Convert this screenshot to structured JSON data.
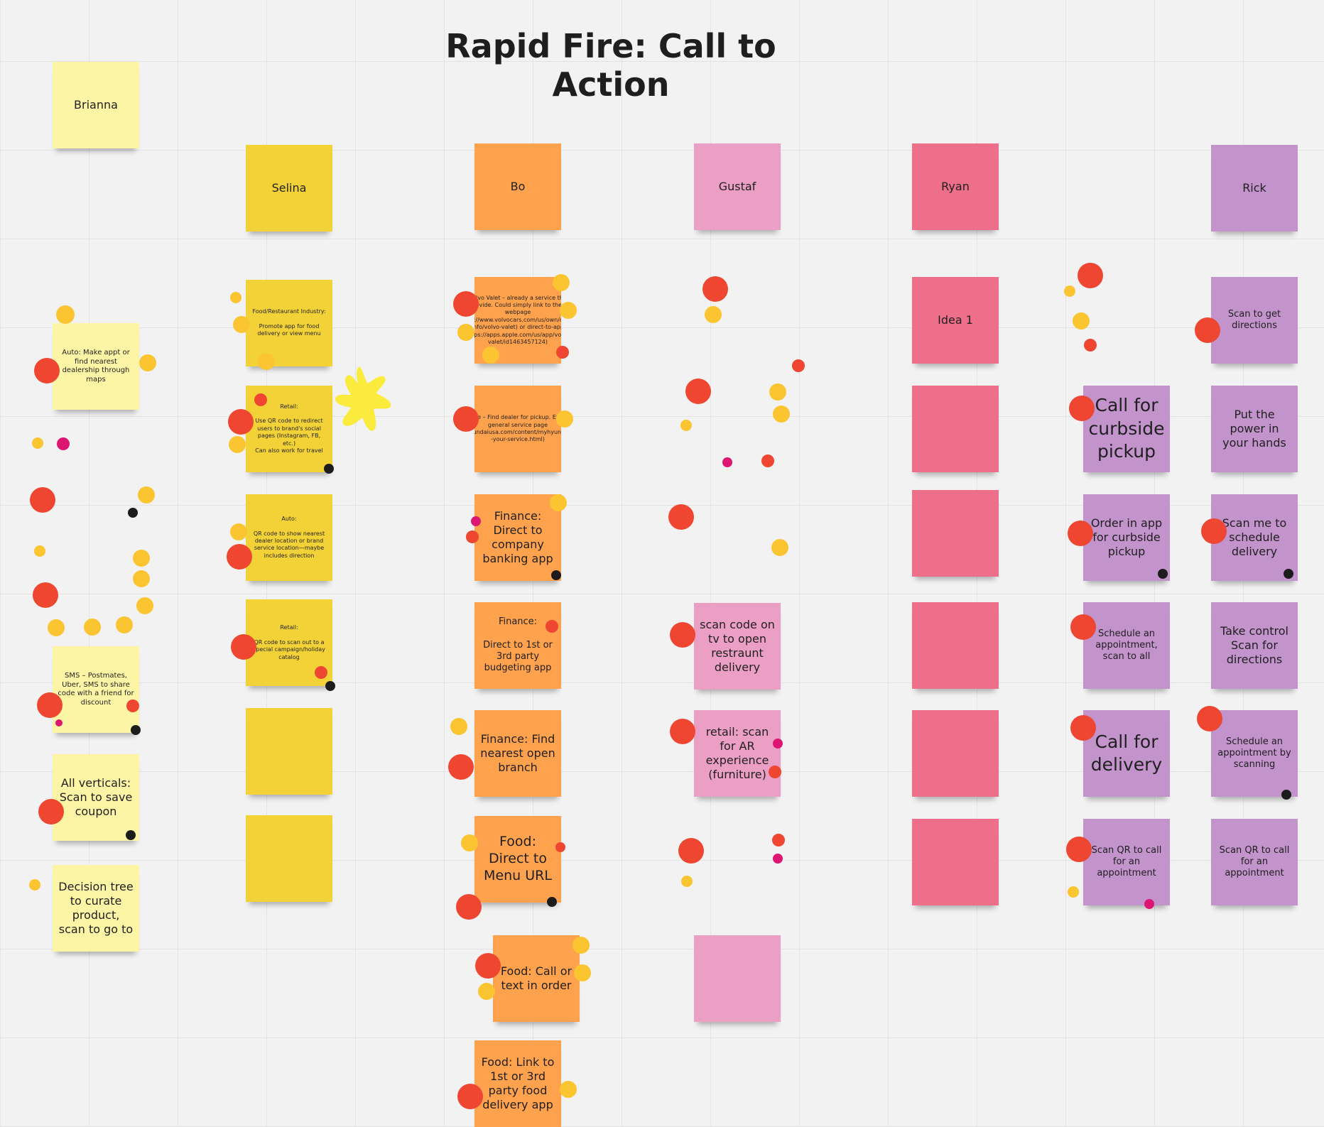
{
  "title": "Rapid Fire: Call to Action",
  "colors": {
    "yellow_light": "#fdf5a6",
    "yellow": "#f3d237",
    "orange": "#fea24e",
    "pink_light": "#ec9fc4",
    "pink": "#ed6f8a",
    "purple": "#c393cc",
    "vote_red": "#ef4631",
    "vote_yellow": "#fbc531",
    "vote_magenta": "#dc1672",
    "vote_black": "#1c1c1c"
  },
  "columns": [
    {
      "key": "brianna",
      "header": "Brianna",
      "notes": [
        "Auto: Make appt or find nearest dealership through maps",
        "SMS – Postmates, Uber, SMS to share code with a friend for discount",
        "All verticals: Scan to save coupon",
        "Decision tree to curate product, scan to go to"
      ]
    },
    {
      "key": "selina",
      "header": "Selina",
      "notes": [
        "Food/Restaurant Industry:\n\nPromote app for food delivery or view menu",
        "Retail:\n\nUse QR code to redirect users to brand's social pages (Instagram, FB, etc.)\nCan also work for travel",
        "Auto:\n\nQR code to show nearest dealer location or brand service location—maybe includes direction",
        "Retail:\n\nQR code to scan out to a special campaign/holiday catalog",
        "",
        ""
      ]
    },
    {
      "key": "bo",
      "header": "Bo",
      "notes": [
        "Volvo Valet – already a service the provide. Could simply link to their webpage (https://www.volvocars.com/us/own/owner-info/volvo-valet) or direct-to-app (https://apps.apple.com/us/app/volvo-valet/id1463457124)",
        "Generic car service – Find dealer for pickup. Example of Hyundai general service page (https://owners.hyundaiusa.com/content/myhyundai/us/en/schedule-your-service.html)",
        "Finance: Direct to company banking app",
        "Finance:\n\nDirect to 1st or 3rd party budgeting app",
        "Finance: Find nearest open branch",
        "Food: Direct to Menu URL",
        "Food: Call or text in order",
        "Food: Link to 1st or 3rd party food delivery app"
      ]
    },
    {
      "key": "gustaf",
      "header": "Gustaf",
      "notes": [
        "scan code on tv to open restraunt delivery",
        "retail: scan for AR experience (furniture)",
        ""
      ]
    },
    {
      "key": "ryan",
      "header": "Ryan",
      "notes": [
        "Idea 1",
        "",
        "",
        "",
        "",
        ""
      ]
    },
    {
      "key": "rick-a",
      "notes": [
        "Call for curbside pickup",
        "Order in app for curbside pickup",
        "Schedule an appointment, scan to all",
        "Call for delivery",
        "Scan QR to call for an appointment"
      ]
    },
    {
      "key": "rick",
      "header": "Rick",
      "notes": [
        "Scan to get directions",
        "Put the power in your hands",
        "Scan me to schedule delivery",
        "Take control Scan for directions",
        "Schedule an appointment by scanning",
        "Scan QR to call for an appointment"
      ]
    }
  ]
}
